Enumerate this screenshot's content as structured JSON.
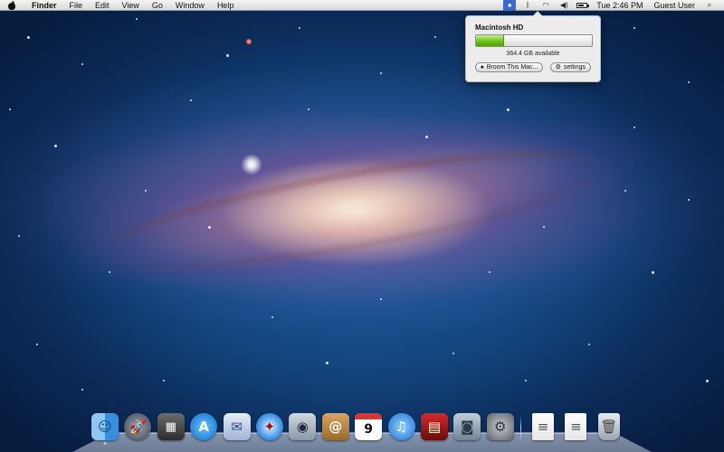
{
  "menubar": {
    "app_name": "Finder",
    "menus": [
      "File",
      "Edit",
      "View",
      "Go",
      "Window",
      "Help"
    ],
    "status_icons": [
      "broom-icon",
      "bluetooth-icon",
      "wifi-icon",
      "volume-icon",
      "battery-icon"
    ],
    "clock": "Tue 2:46 PM",
    "user": "Guest User",
    "search_icon": "spotlight-search-icon"
  },
  "popover": {
    "disk_name": "Macintosh HD",
    "used_fraction": 0.24,
    "available": "364.4 GB available",
    "broom_button": "Broom This Mac...",
    "settings_button": "settings",
    "colors": {
      "bar_fill": "#6cc21b",
      "background": "#ececec"
    }
  },
  "dock": {
    "apps": [
      {
        "name": "finder-icon",
        "glyph": "☺",
        "running": true
      },
      {
        "name": "launchpad-icon",
        "glyph": "🚀",
        "running": false
      },
      {
        "name": "mission-control-icon",
        "glyph": "▦",
        "running": false
      },
      {
        "name": "app-store-icon",
        "glyph": "A",
        "running": false
      },
      {
        "name": "mail-icon",
        "glyph": "✉",
        "running": false
      },
      {
        "name": "safari-icon",
        "glyph": "✦",
        "running": false
      },
      {
        "name": "facetime-icon",
        "glyph": "◉",
        "running": false
      },
      {
        "name": "address-book-icon",
        "glyph": "@",
        "running": false
      },
      {
        "name": "ical-icon",
        "glyph": "9",
        "running": false
      },
      {
        "name": "itunes-icon",
        "glyph": "♫",
        "running": false
      },
      {
        "name": "photo-booth-icon",
        "glyph": "▤",
        "running": false
      },
      {
        "name": "iphoto-icon",
        "glyph": "◙",
        "running": false
      },
      {
        "name": "system-preferences-icon",
        "glyph": "⚙",
        "running": false
      }
    ],
    "stacks": [
      {
        "name": "documents-stack-icon",
        "glyph": "≡"
      },
      {
        "name": "downloads-stack-icon",
        "glyph": "≡"
      }
    ],
    "trash": {
      "name": "trash-icon",
      "glyph": "🗑"
    }
  }
}
